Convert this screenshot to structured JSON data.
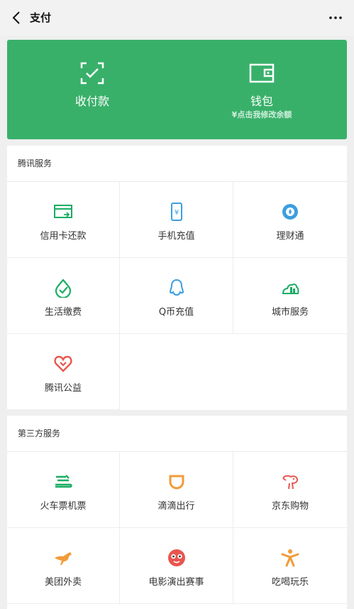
{
  "nav": {
    "title": "支付"
  },
  "hero": {
    "receive_label": "收付款",
    "wallet_label": "钱包",
    "wallet_sub": "¥点击我修改余额"
  },
  "tencent": {
    "title": "腾讯服务",
    "items": [
      {
        "label": "信用卡还款",
        "icon": "credit-card-icon"
      },
      {
        "label": "手机充值",
        "icon": "phone-recharge-icon"
      },
      {
        "label": "理财通",
        "icon": "wealth-icon"
      },
      {
        "label": "生活缴费",
        "icon": "utility-bill-icon"
      },
      {
        "label": "Q币充值",
        "icon": "qq-penguin-icon"
      },
      {
        "label": "城市服务",
        "icon": "city-service-icon"
      },
      {
        "label": "腾讯公益",
        "icon": "charity-heart-icon"
      }
    ]
  },
  "third_party": {
    "title": "第三方服务",
    "items": [
      {
        "label": "火车票机票",
        "icon": "train-ticket-icon"
      },
      {
        "label": "滴滴出行",
        "icon": "didi-icon"
      },
      {
        "label": "京东购物",
        "icon": "jd-dog-icon"
      },
      {
        "label": "美团外卖",
        "icon": "meituan-kangaroo-icon"
      },
      {
        "label": "电影演出赛事",
        "icon": "movie-cat-icon"
      },
      {
        "label": "吃喝玩乐",
        "icon": "leisure-person-icon"
      }
    ]
  },
  "colors": {
    "hero_green": "#39b06a",
    "tencent_green": "#1aad63",
    "blue": "#3c9ee0",
    "red": "#e8564f",
    "orange": "#f29b38"
  }
}
